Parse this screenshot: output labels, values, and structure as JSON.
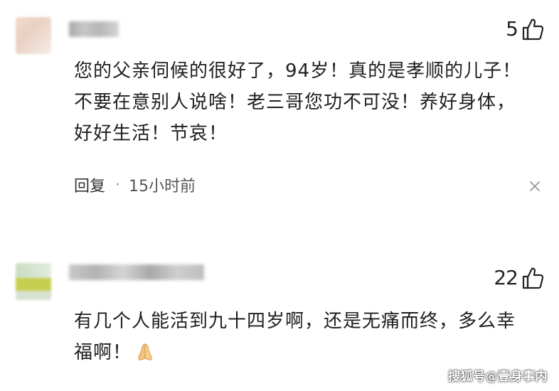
{
  "comments": [
    {
      "likes": "5",
      "text_lines": [
        "您的父亲伺候的很好了，94岁！真的是孝顺的儿子！",
        "不要在意别人说啥！老三哥您功不可没！养好身体，",
        "好好生活！节哀！"
      ],
      "reply_label": "回复",
      "separator": "·",
      "time": "15小时前"
    },
    {
      "likes": "22",
      "text_lines": [
        "有几个人能活到九十四岁啊，还是无痛而终，多么幸",
        "福啊！"
      ],
      "emoji": "folded-hands-icon"
    }
  ],
  "watermark": "搜狐号@壹身事内",
  "colors": {
    "text": "#1f1f1f",
    "meta": "#444444",
    "background": "#ffffff"
  }
}
